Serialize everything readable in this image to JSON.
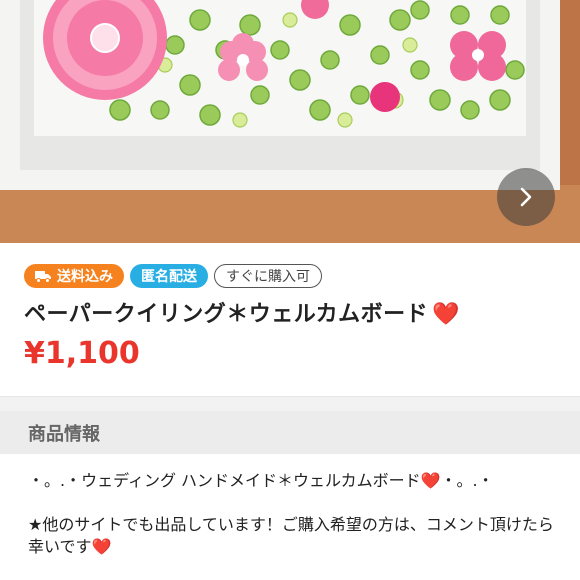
{
  "badges": {
    "shipping": "送料込み",
    "anonymous": "匿名配送",
    "instant": "すぐに購入可"
  },
  "product": {
    "title": "ペーパークイリング＊ウェルカムボード",
    "title_emoji": "❤️",
    "price": "¥1,100"
  },
  "section": {
    "heading": "商品情報"
  },
  "description": {
    "line1": "・。.・ウェディング ハンドメイド＊ウェルカムボード",
    "line1_emoji": "❤️",
    "line1_tail": "・。.・",
    "line2": "★他のサイトでも出品しています！ご購入希望の方は、コメント頂けたら幸いです",
    "line2_emoji": "❤️"
  },
  "colors": {
    "price": "#ea352d",
    "shipping_badge": "#f5821f",
    "anonymous_badge": "#29aee3"
  }
}
